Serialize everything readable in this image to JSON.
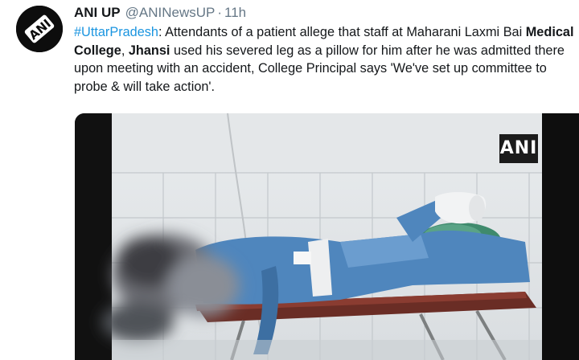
{
  "tweet": {
    "author_name": "ANI UP",
    "handle": "@ANINewsUP",
    "separator": "·",
    "time": "11h",
    "avatar_text": "ANI",
    "text": {
      "hashtag": "#UttarPradesh",
      "part1": ": Attendants of a patient allege that staff at Maharani Laxmi Bai ",
      "bold1": "Medical College",
      "part2": ", ",
      "bold2": "Jhansi",
      "part3": " used his severed leg as a pillow for him after he was admitted there upon meeting with an accident, College Principal says 'We've set up committee to probe & will take action'."
    },
    "media": {
      "watermark": "ANI"
    }
  },
  "colors": {
    "link": "#1b95e0",
    "text": "#14171a",
    "muted": "#657786"
  }
}
